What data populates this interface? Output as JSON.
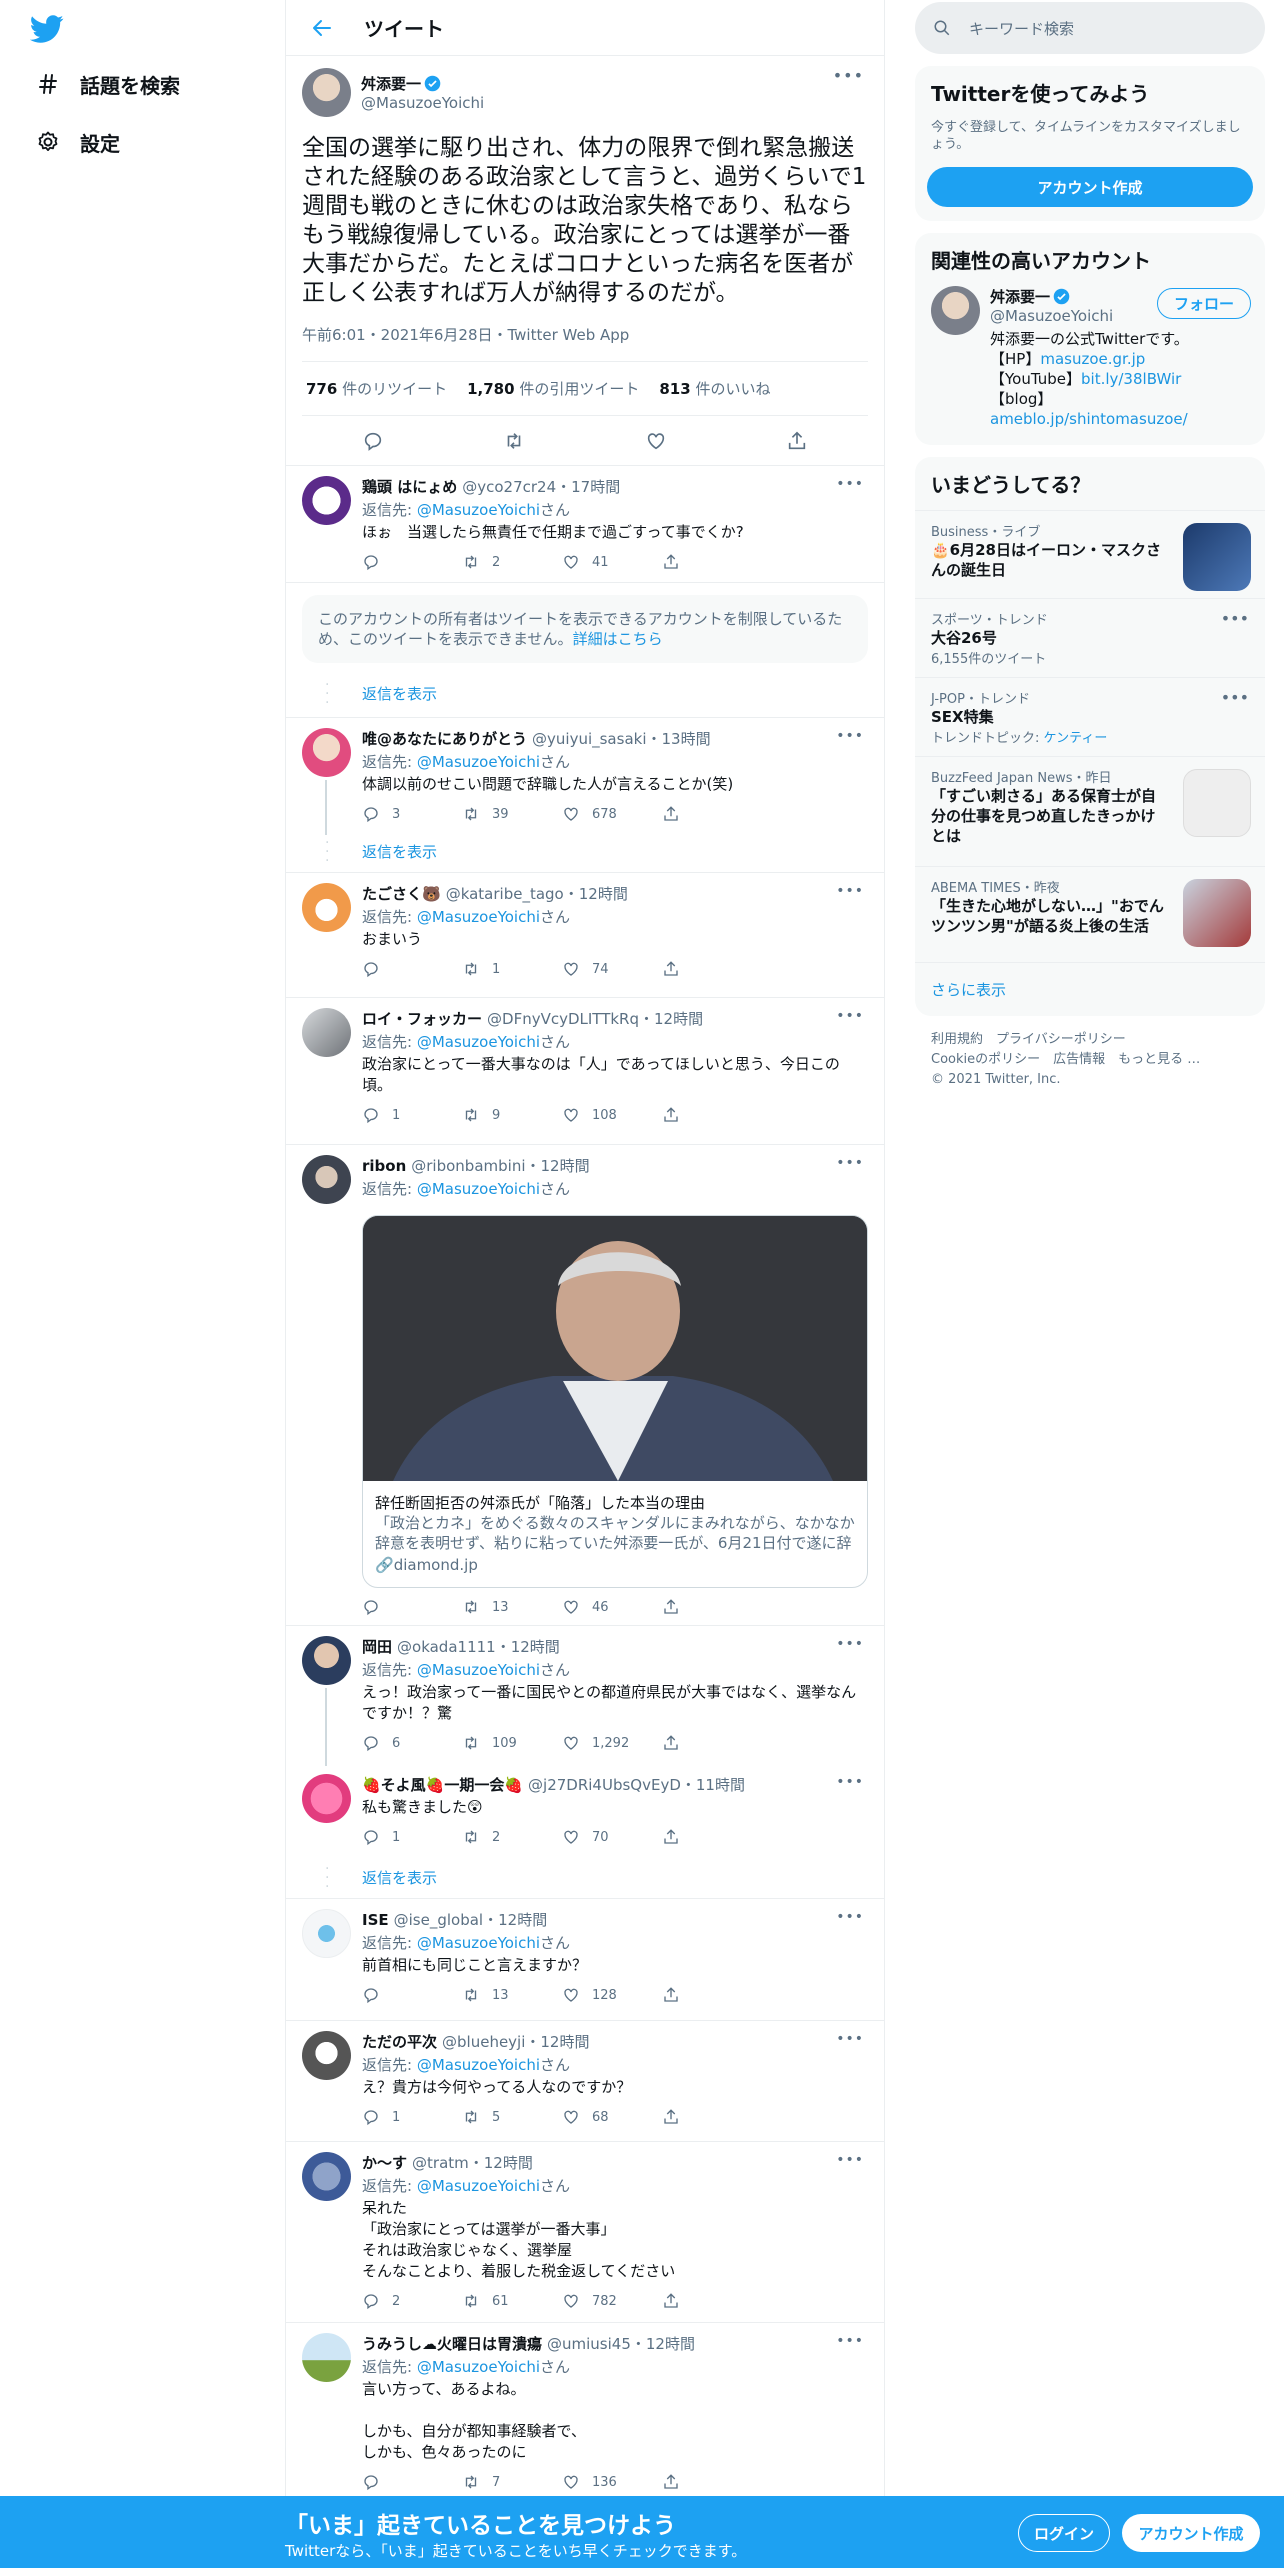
{
  "nav": {
    "explore": "話題を検索",
    "settings": "設定"
  },
  "header": {
    "title": "ツイート"
  },
  "focal": {
    "name": "舛添要一",
    "handle": "@MasuzoeYoichi",
    "text": "全国の選挙に駆り出され、体力の限界で倒れ緊急搬送された経験のある政治家として言うと、過労くらいで1週間も戦のときに休むのは政治家失格であり、私ならもう戦線復帰している。政治家にとっては選挙が一番大事だからだ。たとえばコロナといった病名を医者が正しく公表すれば万人が納得するのだが。",
    "meta": "午前6:01・2021年6月28日・Twitter Web App",
    "retweets": "776",
    "retweets_label": "件のリツイート",
    "quotes": "1,780",
    "quotes_label": "件の引用ツイート",
    "likes": "813",
    "likes_label": "件のいいね"
  },
  "reply_prefix": "返信先:",
  "reply_to": "@MasuzoeYoichi",
  "reply_suffix": "さん",
  "show_replies": "返信を表示",
  "restricted": {
    "text": "このアカウントの所有者はツイートを表示できるアカウントを制限しているため、このツイートを表示できません。",
    "link": "詳細はこちら"
  },
  "replies": [
    {
      "name": "鶏頭 はにょめ",
      "handle": "@yco27cr24",
      "time": "・17時間",
      "text": "ほぉ　当選したら無責任で任期まで過ごすって事でくか?",
      "replies": "",
      "retweets": "2",
      "likes": "41"
    },
    {
      "name": "唯@あなたにありがとう",
      "handle": "@yuiyui_sasaki",
      "time": "・13時間",
      "text": "体調以前のせこい問題で辞職した人が言えることか(笑)",
      "replies": "3",
      "retweets": "39",
      "likes": "678"
    },
    {
      "name": "たごさく🐻",
      "handle": "@kataribe_tago",
      "time": "・12時間",
      "text": "おまいう",
      "replies": "",
      "retweets": "1",
      "likes": "74"
    },
    {
      "name": "ロイ・フォッカー",
      "handle": "@DFnyVcyDLITTkRq",
      "time": "・12時間",
      "text": "政治家にとって一番大事なのは「人」であってほしいと思う、今日この頃。",
      "replies": "1",
      "retweets": "9",
      "likes": "108"
    },
    {
      "name": "ribon",
      "handle": "@ribonbambini",
      "time": "・12時間",
      "text": "",
      "replies": "",
      "retweets": "13",
      "likes": "46"
    },
    {
      "name": "岡田",
      "handle": "@okada1111",
      "time": "・12時間",
      "text": "えっ！政治家って一番に国民やとの都道府県民が大事ではなく、選挙なんですか！？驚",
      "replies": "6",
      "retweets": "109",
      "likes": "1,292"
    },
    {
      "name": "🍓そよ風🍓一期一会🍓",
      "handle": "@j27DRi4UbsQvEyD",
      "time": "・11時間",
      "text": "私も驚きました😲",
      "replies": "1",
      "retweets": "2",
      "likes": "70"
    },
    {
      "name": "ISE",
      "handle": "@ise_global",
      "time": "・12時間",
      "text": "前首相にも同じこと言えますか？",
      "replies": "",
      "retweets": "13",
      "likes": "128"
    },
    {
      "name": "ただの平次",
      "handle": "@blueheyji",
      "time": "・12時間",
      "text": "え？貴方は今何やってる人なのですか？",
      "replies": "1",
      "retweets": "5",
      "likes": "68"
    },
    {
      "name": "か～す",
      "handle": "@tratm",
      "time": "・12時間",
      "text": "呆れた\n「政治家にとっては選挙が一番大事」\nそれは政治家じゃなく、選挙屋\nそんなことより、着服した税金返してください",
      "replies": "2",
      "retweets": "61",
      "likes": "782"
    },
    {
      "name": "うみうし☁火曜日は胃潰瘍",
      "handle": "@umiusi45",
      "time": "・12時間",
      "text": "言い方って、あるよね。\n\nしかも、自分が都知事経験者で、\nしかも、色々あったのに",
      "replies": "",
      "retweets": "7",
      "likes": "136"
    }
  ],
  "card": {
    "title": "辞任断固拒否の舛添氏が「陥落」した本当の理由",
    "desc": "「政治とカネ」をめぐる数々のスキャンダルにまみれながら、なかなか辞意を表明せず、粘りに粘っていた舛添要一氏が、6月21日付で遂に辞職する。",
    "domain": "diamond.jp"
  },
  "right": {
    "search_placeholder": "キーワード検索",
    "signup_title": "Twitterを使ってみよう",
    "signup_sub": "今すぐ登録して、タイムラインをカスタマイズしましょう。",
    "signup_button": "アカウント作成",
    "related_title": "関連性の高いアカウント",
    "related": {
      "name": "舛添要一",
      "handle": "@MasuzoeYoichi",
      "follow": "フォロー",
      "bio1": "舛添要一の公式Twitterです。",
      "bio2_label": "【HP】",
      "bio2_link": "masuzoe.gr.jp",
      "bio3_label": "【YouTube】",
      "bio3_link": "bit.ly/38lBWir",
      "bio4_label": "【blog】",
      "bio4_link": "ameblo.jp/shintomasuzoe/"
    },
    "trends_title": "いまどうしてる？",
    "trends": [
      {
        "cat": "Business・ライブ",
        "title": "🎂6月28日はイーロン・マスクさんの誕生日",
        "count": ""
      },
      {
        "cat": "スポーツ・トレンド",
        "title": "大谷26号",
        "count": "6,155件のツイート"
      },
      {
        "cat": "J-POP・トレンド",
        "title": "SEX特集",
        "count": "トレンドトピック: ",
        "count_link": "ケンティー"
      },
      {
        "cat": "BuzzFeed Japan News・昨日",
        "title": "「すごい刺さる」ある保育士が自分の仕事を見つめ直したきっかけとは",
        "count": ""
      },
      {
        "cat": "ABEMA TIMES・昨夜",
        "title": "「生きた心地がしない…」\"おでんツンツン男\"が語る炎上後の生活",
        "count": ""
      }
    ],
    "show_more": "さらに表示",
    "footer1": "利用規約　プライバシーポリシー",
    "footer2": "Cookieのポリシー　広告情報　もっと見る …",
    "footer3": "© 2021 Twitter, Inc."
  },
  "bottom": {
    "title": "「いま」起きていることを見つけよう",
    "sub": "Twitterなら、「いま」起きていることをいち早くチェックできます。",
    "login": "ログイン",
    "signup": "アカウント作成"
  },
  "colors": {
    "accent": "#1da1f2",
    "link": "#1b95e0"
  }
}
